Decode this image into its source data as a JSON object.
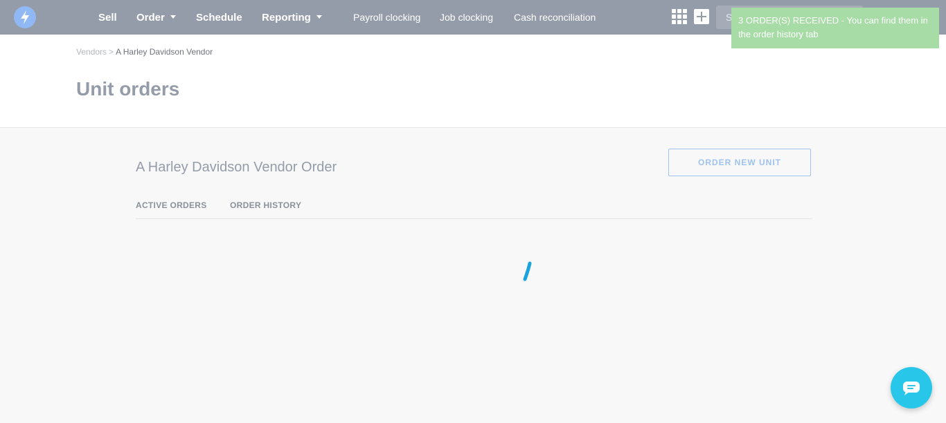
{
  "nav": {
    "main_items": [
      {
        "label": "Sell",
        "has_dropdown": false
      },
      {
        "label": "Order",
        "has_dropdown": true
      },
      {
        "label": "Schedule",
        "has_dropdown": false
      },
      {
        "label": "Reporting",
        "has_dropdown": true
      }
    ],
    "secondary_items": [
      "Payroll clocking",
      "Job clocking",
      "Cash reconciliation"
    ],
    "search_placeholder": "S",
    "icons": [
      "logo-bolt-icon",
      "apps-grid-icon",
      "add-icon",
      "chevron-down-icon"
    ]
  },
  "toast": {
    "message": "3 ORDER(S) RECEIVED - You can find them in the order history tab"
  },
  "breadcrumb": {
    "parent": "Vendors",
    "separator": ">",
    "current": "A Harley Davidson Vendor"
  },
  "page": {
    "title": "Unit orders",
    "section_title": "A Harley Davidson Vendor Order",
    "order_button": "ORDER NEW UNIT"
  },
  "tabs": [
    "ACTIVE ORDERS",
    "ORDER HISTORY"
  ],
  "colors": {
    "topbar": "#959ca9",
    "accent": "#28c7ea",
    "toast": "#a7dca6",
    "button_outline": "#9fc2ee",
    "spinner": "#1aa3dc"
  }
}
